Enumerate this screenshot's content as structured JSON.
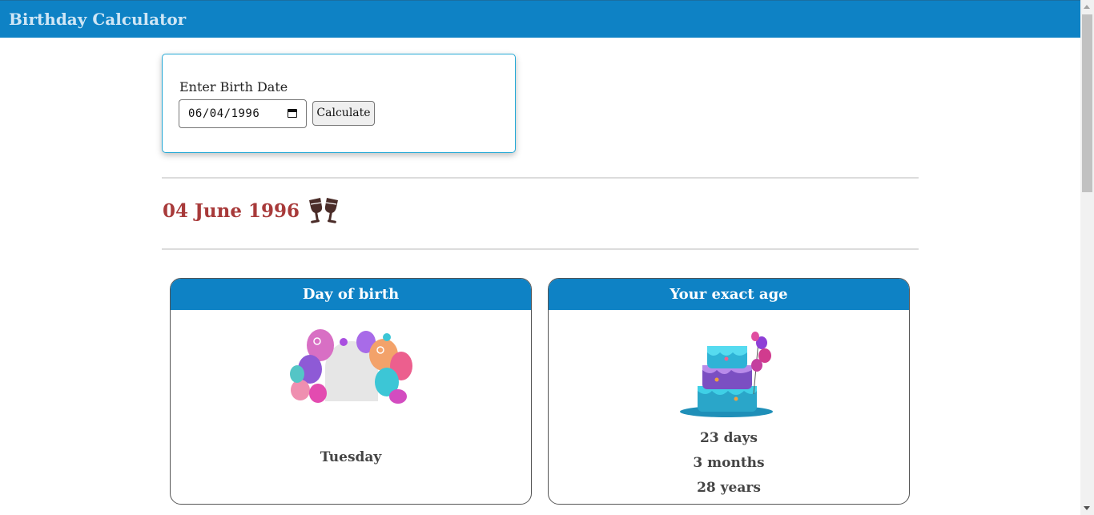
{
  "app": {
    "title": "Birthday Calculator"
  },
  "form": {
    "label": "Enter Birth Date",
    "date_value": "06/04/1996",
    "button_label": "Calculate"
  },
  "result": {
    "date_heading": "04 June 1996",
    "day_card": {
      "title": "Day of birth",
      "day": "Tuesday"
    },
    "age_card": {
      "title": "Your exact age",
      "days": "23 days",
      "months": "3 months",
      "years": "28 years"
    }
  },
  "icons": {
    "celebration": "cheers-icon",
    "calendar": "calendar-icon",
    "day_image": "balloons-image",
    "age_image": "birthday-cake-image"
  },
  "colors": {
    "brand": "#0e82c5",
    "date_heading": "#a83a3a",
    "input_card_border": "#25a9d6"
  }
}
